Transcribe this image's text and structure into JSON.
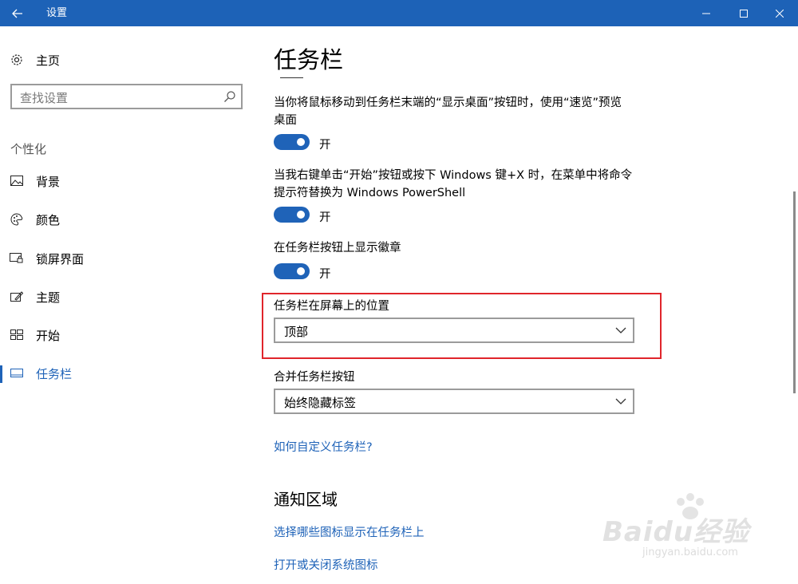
{
  "window": {
    "title": "设置"
  },
  "sidebar": {
    "home_label": "主页",
    "search_placeholder": "查找设置",
    "section_label": "个性化",
    "items": [
      {
        "label": "背景",
        "icon": "picture-icon"
      },
      {
        "label": "颜色",
        "icon": "palette-icon"
      },
      {
        "label": "锁屏界面",
        "icon": "lock-screen-icon"
      },
      {
        "label": "主题",
        "icon": "theme-icon"
      },
      {
        "label": "开始",
        "icon": "start-icon"
      },
      {
        "label": "任务栏",
        "icon": "taskbar-icon",
        "active": true
      }
    ]
  },
  "main": {
    "title": "任务栏",
    "settings": [
      {
        "description": "当你将鼠标移动到任务栏末端的“显示桌面”按钮时，使用“速览”预览桌面",
        "state": "开",
        "on": true
      },
      {
        "description": "当我右键单击“开始”按钮或按下 Windows 键+X 时，在菜单中将命令提示符替换为 Windows PowerShell",
        "state": "开",
        "on": true
      },
      {
        "description": "在任务栏按钮上显示徽章",
        "state": "开",
        "on": true
      }
    ],
    "position": {
      "label": "任务栏在屏幕上的位置",
      "value": "顶部"
    },
    "combine": {
      "label": "合并任务栏按钮",
      "value": "始终隐藏标签"
    },
    "help_link": "如何自定义任务栏?",
    "notification_title": "通知区域",
    "notification_links": [
      "选择哪些图标显示在任务栏上",
      "打开或关闭系统图标"
    ]
  },
  "watermark": {
    "brand": "Baidu经验",
    "url": "jingyan.baidu.com"
  },
  "colors": {
    "accent": "#1f63b8",
    "titlebar": "#1d62b7",
    "highlight": "#e0252b"
  }
}
